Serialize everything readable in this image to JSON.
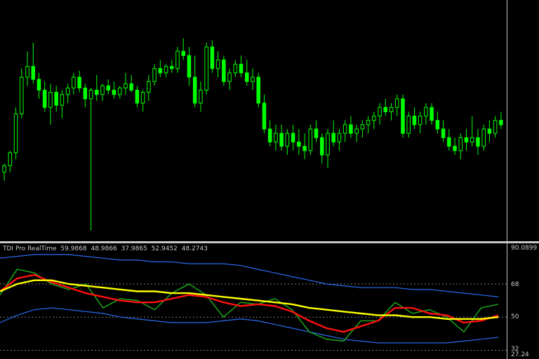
{
  "colors": {
    "background": "#000000",
    "candle": "#00ff00",
    "rsi_line": "#1a9f1a",
    "signal_line": "#ff1010",
    "market_base_line": "#ffff00",
    "volatility_band": "#2a6cf0",
    "level_line": "#7d7d7d",
    "text": "#c8c8c8"
  },
  "indicator": {
    "name": "TDI Pro RealTime",
    "values": [
      "59.9868",
      "48.9866",
      "37.9865",
      "52.9452",
      "48.2743"
    ]
  },
  "axis": {
    "max": "90.0899",
    "level_68": "68",
    "level_50": "50",
    "level_32": "32",
    "min": "27.24"
  },
  "chart_data": [
    {
      "type": "candlestick",
      "title": "",
      "description_of_series": "OHLC candles",
      "ylim": [
        0,
        100
      ],
      "candles": [
        {
          "o": 30,
          "h": 34,
          "l": 26,
          "c": 33
        },
        {
          "o": 33,
          "h": 40,
          "l": 30,
          "c": 39
        },
        {
          "o": 39,
          "h": 60,
          "l": 36,
          "c": 57
        },
        {
          "o": 57,
          "h": 78,
          "l": 55,
          "c": 74
        },
        {
          "o": 74,
          "h": 86,
          "l": 70,
          "c": 79
        },
        {
          "o": 79,
          "h": 90,
          "l": 71,
          "c": 73
        },
        {
          "o": 73,
          "h": 76,
          "l": 64,
          "c": 68
        },
        {
          "o": 68,
          "h": 72,
          "l": 58,
          "c": 60
        },
        {
          "o": 60,
          "h": 71,
          "l": 52,
          "c": 67
        },
        {
          "o": 67,
          "h": 70,
          "l": 58,
          "c": 61
        },
        {
          "o": 61,
          "h": 68,
          "l": 55,
          "c": 66
        },
        {
          "o": 66,
          "h": 71,
          "l": 62,
          "c": 69
        },
        {
          "o": 69,
          "h": 76,
          "l": 66,
          "c": 74
        },
        {
          "o": 74,
          "h": 77,
          "l": 67,
          "c": 69
        },
        {
          "o": 69,
          "h": 71,
          "l": 60,
          "c": 64
        },
        {
          "o": 64,
          "h": 69,
          "l": 3,
          "c": 68
        },
        {
          "o": 68,
          "h": 75,
          "l": 63,
          "c": 66
        },
        {
          "o": 66,
          "h": 71,
          "l": 63,
          "c": 70
        },
        {
          "o": 70,
          "h": 73,
          "l": 66,
          "c": 68
        },
        {
          "o": 68,
          "h": 72,
          "l": 64,
          "c": 66
        },
        {
          "o": 66,
          "h": 70,
          "l": 64,
          "c": 69
        },
        {
          "o": 69,
          "h": 76,
          "l": 66,
          "c": 71
        },
        {
          "o": 71,
          "h": 75,
          "l": 67,
          "c": 68
        },
        {
          "o": 68,
          "h": 70,
          "l": 60,
          "c": 62
        },
        {
          "o": 62,
          "h": 68,
          "l": 58,
          "c": 67
        },
        {
          "o": 67,
          "h": 75,
          "l": 63,
          "c": 72
        },
        {
          "o": 72,
          "h": 80,
          "l": 70,
          "c": 78
        },
        {
          "o": 78,
          "h": 82,
          "l": 74,
          "c": 76
        },
        {
          "o": 76,
          "h": 80,
          "l": 74,
          "c": 79
        },
        {
          "o": 79,
          "h": 82,
          "l": 76,
          "c": 78
        },
        {
          "o": 78,
          "h": 88,
          "l": 76,
          "c": 86
        },
        {
          "o": 86,
          "h": 92,
          "l": 82,
          "c": 84
        },
        {
          "o": 84,
          "h": 88,
          "l": 70,
          "c": 74
        },
        {
          "o": 74,
          "h": 84,
          "l": 60,
          "c": 62
        },
        {
          "o": 62,
          "h": 72,
          "l": 58,
          "c": 68
        },
        {
          "o": 68,
          "h": 90,
          "l": 66,
          "c": 88
        },
        {
          "o": 88,
          "h": 91,
          "l": 76,
          "c": 78
        },
        {
          "o": 78,
          "h": 86,
          "l": 74,
          "c": 82
        },
        {
          "o": 82,
          "h": 84,
          "l": 70,
          "c": 72
        },
        {
          "o": 72,
          "h": 78,
          "l": 68,
          "c": 76
        },
        {
          "o": 76,
          "h": 82,
          "l": 74,
          "c": 80
        },
        {
          "o": 80,
          "h": 84,
          "l": 74,
          "c": 76
        },
        {
          "o": 76,
          "h": 82,
          "l": 70,
          "c": 72
        },
        {
          "o": 72,
          "h": 78,
          "l": 68,
          "c": 74
        },
        {
          "o": 74,
          "h": 76,
          "l": 60,
          "c": 62
        },
        {
          "o": 62,
          "h": 66,
          "l": 48,
          "c": 50
        },
        {
          "o": 50,
          "h": 54,
          "l": 42,
          "c": 44
        },
        {
          "o": 44,
          "h": 52,
          "l": 40,
          "c": 48
        },
        {
          "o": 48,
          "h": 52,
          "l": 40,
          "c": 42
        },
        {
          "o": 42,
          "h": 50,
          "l": 38,
          "c": 48
        },
        {
          "o": 48,
          "h": 52,
          "l": 40,
          "c": 44
        },
        {
          "o": 44,
          "h": 50,
          "l": 38,
          "c": 42
        },
        {
          "o": 42,
          "h": 48,
          "l": 36,
          "c": 40
        },
        {
          "o": 40,
          "h": 52,
          "l": 38,
          "c": 50
        },
        {
          "o": 50,
          "h": 54,
          "l": 44,
          "c": 46
        },
        {
          "o": 46,
          "h": 48,
          "l": 34,
          "c": 38
        },
        {
          "o": 38,
          "h": 50,
          "l": 32,
          "c": 48
        },
        {
          "o": 48,
          "h": 54,
          "l": 42,
          "c": 44
        },
        {
          "o": 44,
          "h": 50,
          "l": 40,
          "c": 48
        },
        {
          "o": 48,
          "h": 54,
          "l": 44,
          "c": 52
        },
        {
          "o": 52,
          "h": 56,
          "l": 46,
          "c": 48
        },
        {
          "o": 48,
          "h": 52,
          "l": 44,
          "c": 50
        },
        {
          "o": 50,
          "h": 54,
          "l": 46,
          "c": 52
        },
        {
          "o": 52,
          "h": 56,
          "l": 48,
          "c": 54
        },
        {
          "o": 54,
          "h": 58,
          "l": 50,
          "c": 56
        },
        {
          "o": 56,
          "h": 62,
          "l": 52,
          "c": 60
        },
        {
          "o": 60,
          "h": 64,
          "l": 56,
          "c": 58
        },
        {
          "o": 58,
          "h": 62,
          "l": 54,
          "c": 60
        },
        {
          "o": 60,
          "h": 66,
          "l": 56,
          "c": 64
        },
        {
          "o": 64,
          "h": 66,
          "l": 46,
          "c": 48
        },
        {
          "o": 48,
          "h": 58,
          "l": 46,
          "c": 56
        },
        {
          "o": 56,
          "h": 60,
          "l": 50,
          "c": 52
        },
        {
          "o": 52,
          "h": 58,
          "l": 48,
          "c": 56
        },
        {
          "o": 56,
          "h": 62,
          "l": 52,
          "c": 60
        },
        {
          "o": 60,
          "h": 62,
          "l": 52,
          "c": 54
        },
        {
          "o": 54,
          "h": 58,
          "l": 48,
          "c": 50
        },
        {
          "o": 50,
          "h": 54,
          "l": 44,
          "c": 46
        },
        {
          "o": 46,
          "h": 50,
          "l": 40,
          "c": 42
        },
        {
          "o": 42,
          "h": 46,
          "l": 38,
          "c": 40
        },
        {
          "o": 40,
          "h": 48,
          "l": 36,
          "c": 46
        },
        {
          "o": 46,
          "h": 50,
          "l": 40,
          "c": 44
        },
        {
          "o": 44,
          "h": 56,
          "l": 42,
          "c": 46
        },
        {
          "o": 46,
          "h": 50,
          "l": 38,
          "c": 42
        },
        {
          "o": 42,
          "h": 52,
          "l": 40,
          "c": 50
        },
        {
          "o": 50,
          "h": 54,
          "l": 44,
          "c": 48
        },
        {
          "o": 48,
          "h": 56,
          "l": 46,
          "c": 54
        },
        {
          "o": 54,
          "h": 58,
          "l": 50,
          "c": 52
        }
      ]
    },
    {
      "type": "line",
      "title": "",
      "ylim": [
        27.24,
        90.0899
      ],
      "series": [
        {
          "color": "#2a6cf0",
          "values": [
            82,
            83,
            84,
            84,
            84,
            83,
            82,
            81,
            81,
            80,
            80,
            79,
            79,
            79,
            78,
            76,
            74,
            72,
            70,
            68,
            67,
            66,
            66,
            66,
            65,
            65,
            64,
            63,
            62,
            61
          ]
        },
        {
          "color": "#2a6cf0",
          "values": [
            47,
            51,
            54,
            55,
            54,
            53,
            52,
            50,
            49,
            48,
            47,
            47,
            47,
            48,
            49,
            48,
            46,
            44,
            42,
            40,
            38,
            37,
            36,
            36,
            36,
            36,
            36,
            37,
            38,
            39
          ]
        },
        {
          "color": "#1a9f1a",
          "values": [
            62,
            76,
            74,
            68,
            65,
            68,
            55,
            60,
            59,
            54,
            63,
            68,
            62,
            50,
            58,
            57,
            60,
            54,
            42,
            38,
            37,
            48,
            48,
            58,
            52,
            54,
            50,
            42,
            55,
            57
          ]
        },
        {
          "color": "#ff1010",
          "values": [
            64,
            71,
            73,
            69,
            66,
            63,
            61,
            59,
            58,
            58,
            60,
            62,
            61,
            58,
            56,
            57,
            56,
            53,
            48,
            44,
            42,
            45,
            48,
            55,
            55,
            52,
            51,
            47,
            48,
            51
          ]
        },
        {
          "color": "#ffff00",
          "values": [
            64,
            68,
            70,
            70,
            68,
            67,
            66,
            65,
            64,
            64,
            63,
            63,
            62,
            61,
            60,
            59,
            58,
            57,
            55,
            54,
            53,
            52,
            51,
            51,
            50,
            50,
            49,
            49,
            49,
            50
          ]
        }
      ],
      "levels": [
        68,
        50,
        32
      ]
    }
  ]
}
